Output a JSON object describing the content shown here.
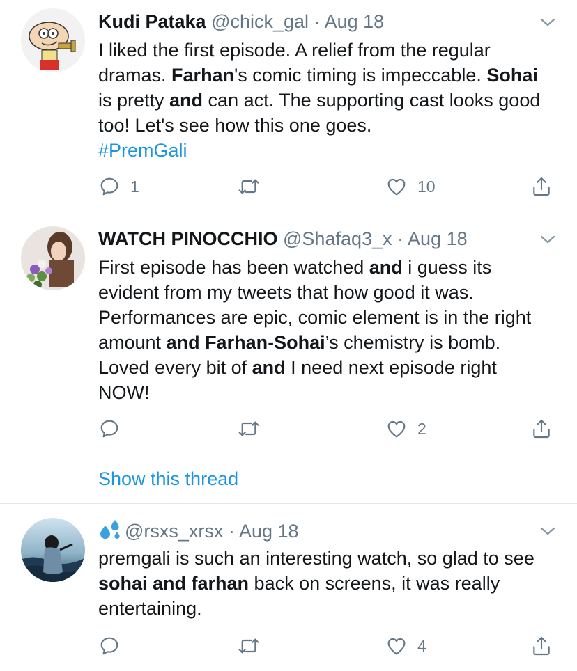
{
  "tweets": [
    {
      "name": "Kudi Pataka",
      "handle": "@chick_gal",
      "sep": " · ",
      "date": "Aug 18",
      "body": [
        [
          {
            "t": "I liked the first episode. A relief from the regular dramas. ",
            "b": false
          },
          {
            "t": "Farhan",
            "b": true
          },
          {
            "t": "'s comic timing is impeccable. ",
            "b": false
          },
          {
            "t": "Sohai",
            "b": true
          },
          {
            "t": " is pretty ",
            "b": false
          },
          {
            "t": "and",
            "b": true
          },
          {
            "t": " can act. The supporting cast looks good too! Let's see how this one goes.",
            "b": false
          }
        ]
      ],
      "hashtag": "#PremGali",
      "replies": "1",
      "retweets": "",
      "likes": "10"
    },
    {
      "name": "WATCH PINOCCHIO",
      "handle": "@Shafaq3_x",
      "sep": " · ",
      "date": "Aug 18",
      "body": [
        [
          {
            "t": "First episode has been watched ",
            "b": false
          },
          {
            "t": "and",
            "b": true
          },
          {
            "t": " i guess its evident from my tweets that how good it was. Performances are epic, comic element is in the right amount ",
            "b": false
          },
          {
            "t": "and Farhan",
            "b": true
          },
          {
            "t": "-",
            "b": false
          },
          {
            "t": "Sohai",
            "b": true
          },
          {
            "t": "’s chemistry is bomb. Loved every bit of ",
            "b": false
          },
          {
            "t": "and",
            "b": true
          },
          {
            "t": " I need next episode right NOW!",
            "b": false
          }
        ]
      ],
      "replies": "",
      "retweets": "",
      "likes": "2",
      "show_thread": "Show this thread"
    },
    {
      "name": "",
      "name_icon": "droplets-emoji-icon",
      "handle": "@rsxs_xrsx",
      "sep": " · ",
      "date": "Aug 18",
      "body": [
        [
          {
            "t": "premgali is such an interesting watch, so glad to see ",
            "b": false
          },
          {
            "t": "sohai and farhan",
            "b": true
          },
          {
            "t": " back on screens, it was really entertaining.",
            "b": false
          }
        ]
      ],
      "replies": "",
      "retweets": "",
      "likes": "4"
    }
  ],
  "colors": {
    "text": "#14171a",
    "muted": "#657786",
    "link": "#1b95e0",
    "divider": "#e1e8ed"
  },
  "icons": {
    "reply": "reply-icon",
    "retweet": "retweet-icon",
    "like": "heart-icon",
    "share": "share-icon",
    "menu": "chevron-down-icon"
  }
}
